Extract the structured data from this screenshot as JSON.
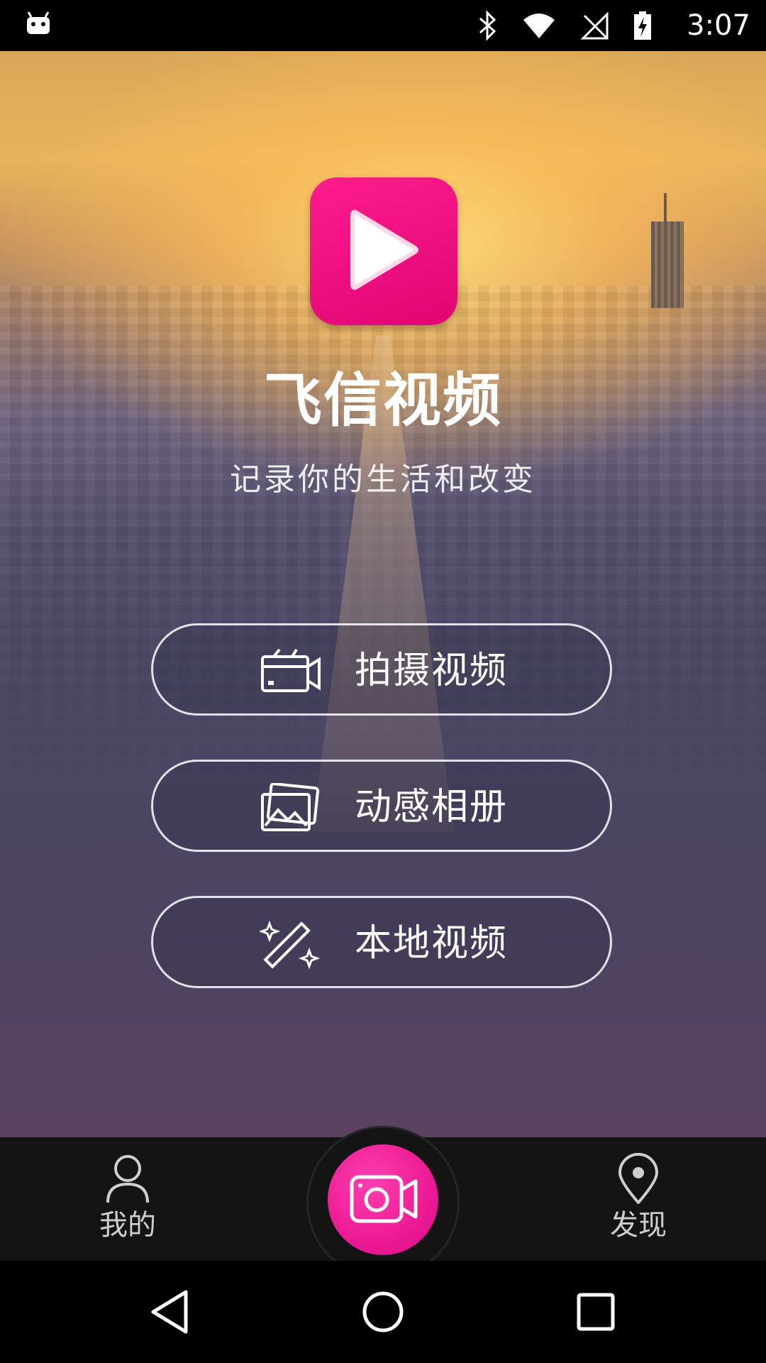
{
  "status_bar": {
    "time": "3:07",
    "icons": [
      "android-icon",
      "bluetooth-icon",
      "wifi-icon",
      "no-sim-icon",
      "battery-charging-icon"
    ]
  },
  "app": {
    "title": "飞信视频",
    "subtitle": "记录你的生活和改变"
  },
  "menu": {
    "items": [
      {
        "label": "拍摄视频",
        "icon": "video-camera-icon"
      },
      {
        "label": "动感相册",
        "icon": "photo-album-icon"
      },
      {
        "label": "本地视频",
        "icon": "magic-wand-icon"
      }
    ]
  },
  "bottom_nav": {
    "left": {
      "label": "我的",
      "icon": "person-icon"
    },
    "center": {
      "icon": "record-camera-icon"
    },
    "right": {
      "label": "发现",
      "icon": "location-pin-icon"
    }
  },
  "colors": {
    "accent": "#E8097A",
    "record_button": "#EC1A94",
    "nav_background": "#141414"
  }
}
